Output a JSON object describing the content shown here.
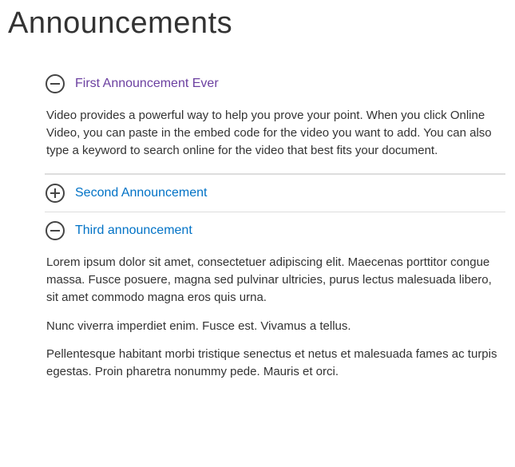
{
  "page": {
    "title": "Announcements"
  },
  "announcements": [
    {
      "expanded": true,
      "visited": true,
      "icon": "minus-circle-icon",
      "title": "First Announcement Ever",
      "body": [
        "Video provides a powerful way to help you prove your point. When you click Online Video, you can paste in the embed code for the video you want to add. You can also type a keyword to search online for the video that best fits your document."
      ]
    },
    {
      "expanded": false,
      "visited": false,
      "icon": "plus-circle-icon",
      "title": "Second Announcement",
      "body": []
    },
    {
      "expanded": true,
      "visited": false,
      "icon": "minus-circle-icon",
      "title": "Third announcement",
      "body": [
        "Lorem ipsum dolor sit amet, consectetuer adipiscing elit. Maecenas porttitor congue massa. Fusce posuere, magna sed pulvinar ultricies, purus lectus malesuada libero, sit amet commodo magna eros quis urna.",
        "Nunc viverra imperdiet enim. Fusce est. Vivamus a tellus.",
        "Pellentesque habitant morbi tristique senectus et netus et malesuada fames ac turpis egestas. Proin pharetra nonummy pede. Mauris et orci."
      ]
    }
  ]
}
